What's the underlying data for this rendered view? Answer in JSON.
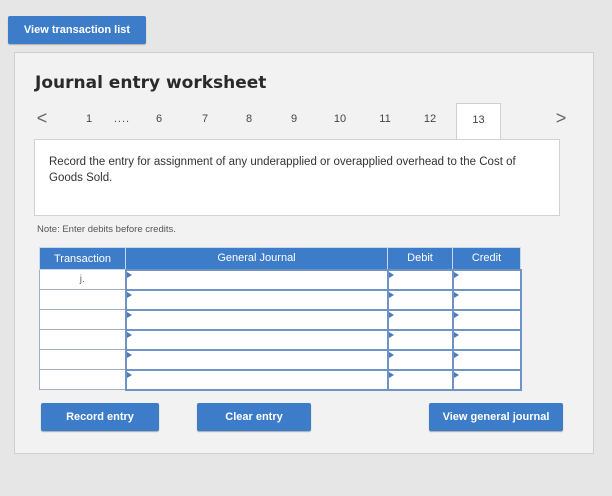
{
  "top": {
    "view_transaction_list": "View transaction list"
  },
  "worksheet": {
    "title": "Journal entry worksheet",
    "pager": {
      "prev": "<",
      "next": ">",
      "pages": [
        "1",
        "....",
        "6",
        "7",
        "8",
        "9",
        "10",
        "11",
        "12",
        "13"
      ],
      "active": "13"
    },
    "instruction": "Record the entry for assignment of any underapplied or overapplied overhead to the Cost of Goods Sold.",
    "note": "Note: Enter debits before credits."
  },
  "table": {
    "headers": [
      "Transaction",
      "General Journal",
      "Debit",
      "Credit"
    ],
    "rows": [
      {
        "transaction": "j.",
        "general_journal": "",
        "debit": "",
        "credit": ""
      },
      {
        "transaction": "",
        "general_journal": "",
        "debit": "",
        "credit": ""
      },
      {
        "transaction": "",
        "general_journal": "",
        "debit": "",
        "credit": ""
      },
      {
        "transaction": "",
        "general_journal": "",
        "debit": "",
        "credit": ""
      },
      {
        "transaction": "",
        "general_journal": "",
        "debit": "",
        "credit": ""
      },
      {
        "transaction": "",
        "general_journal": "",
        "debit": "",
        "credit": ""
      }
    ]
  },
  "buttons": {
    "record_entry": "Record entry",
    "clear_entry": "Clear entry",
    "view_general_journal": "View general journal"
  },
  "colors": {
    "accent": "#3d7cc9"
  }
}
